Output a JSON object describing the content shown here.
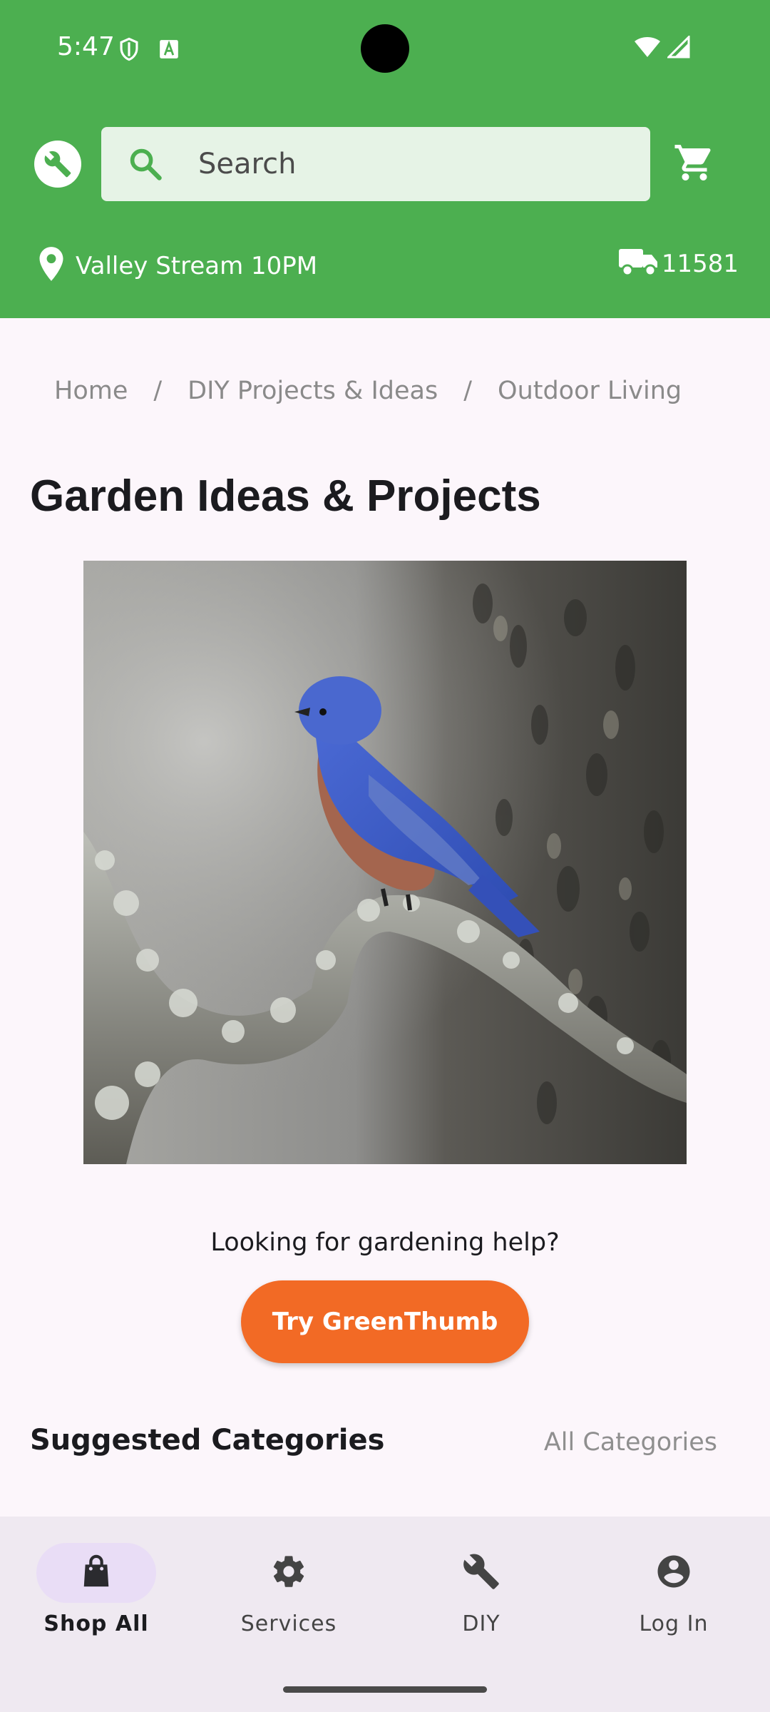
{
  "status_bar": {
    "time": "5:47"
  },
  "header": {
    "search_placeholder": "Search",
    "location": "Valley Stream 10PM",
    "zip": "11581"
  },
  "breadcrumb": {
    "items": [
      "Home",
      "DIY Projects & Ideas",
      "Outdoor Living"
    ],
    "separator": "/"
  },
  "main": {
    "title": "Garden Ideas & Projects",
    "help_text": "Looking for gardening help?",
    "cta_label": "Try GreenThumb",
    "section_title": "Suggested Categories",
    "section_link": "All Categories"
  },
  "bottom_nav": {
    "items": [
      {
        "label": "Shop All",
        "icon": "shopping-bag-icon",
        "active": true
      },
      {
        "label": "Services",
        "icon": "gear-icon",
        "active": false
      },
      {
        "label": "DIY",
        "icon": "wrench-icon",
        "active": false
      },
      {
        "label": "Log In",
        "icon": "account-icon",
        "active": false
      }
    ]
  },
  "colors": {
    "header_green": "#4caf50",
    "cta_orange": "#f26a25",
    "background": "#fcf6fb",
    "nav_background": "#efe9f1",
    "nav_active_pill": "#e9ddf6"
  }
}
